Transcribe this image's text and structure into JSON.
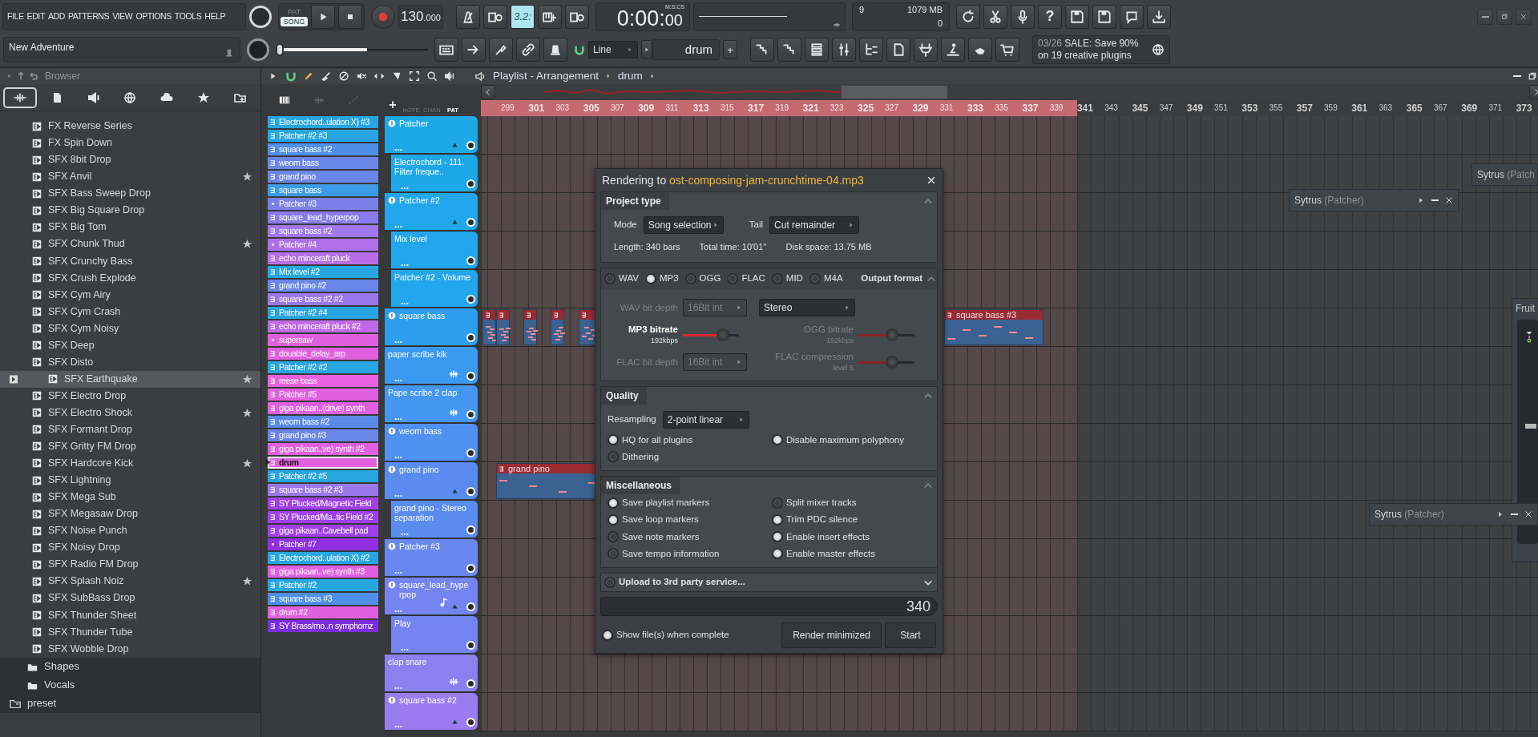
{
  "menu": [
    "FILE",
    "EDIT",
    "ADD",
    "PATTERNS",
    "VIEW",
    "OPTIONS",
    "TOOLS",
    "HELP"
  ],
  "transport": {
    "modes": [
      {
        "label": "PAT",
        "selected": false
      },
      {
        "label": "SONG",
        "selected": true
      }
    ],
    "tempo": "130",
    "tempo_fraction": ".000"
  },
  "tools": {
    "countdown": {
      "label": "3.2:",
      "on": true
    },
    "help": "?"
  },
  "time": {
    "main": "0:00:",
    "small": "00",
    "format": "M:S:CS"
  },
  "monitor": {
    "readout_1": "9",
    "memory": "1079 MB",
    "readout_2": "0"
  },
  "project_title": "New Adventure",
  "master_volume": {
    "level": 0.6
  },
  "snap": "Line",
  "pattern_selector": {
    "value": "drum",
    "add": "+"
  },
  "news": {
    "date": "03/26",
    "text": "SALE: Save 90% on 19 creative plugins"
  },
  "browser": {
    "title": "Browser",
    "tabs": [
      {
        "selected": true
      },
      {
        "selected": false
      },
      {
        "selected": false
      },
      {
        "selected": false
      },
      {
        "selected": false
      },
      {
        "selected": false
      },
      {
        "selected": false
      }
    ],
    "items": [
      {
        "name": "FX Reverse Series",
        "starred": false,
        "selected": false
      },
      {
        "name": "FX Spin Down",
        "starred": false,
        "selected": false
      },
      {
        "name": "SFX 8bit Drop",
        "starred": false,
        "selected": false
      },
      {
        "name": "SFX Anvil",
        "starred": true,
        "selected": false
      },
      {
        "name": "SFX Bass Sweep Drop",
        "starred": false,
        "selected": false
      },
      {
        "name": "SFX Big Square Drop",
        "starred": false,
        "selected": false
      },
      {
        "name": "SFX Big Tom",
        "starred": false,
        "selected": false
      },
      {
        "name": "SFX Chunk Thud",
        "starred": true,
        "selected": false
      },
      {
        "name": "SFX Crunchy Bass",
        "starred": false,
        "selected": false
      },
      {
        "name": "SFX Crush Explode",
        "starred": false,
        "selected": false
      },
      {
        "name": "SFX Cym Airy",
        "starred": false,
        "selected": false
      },
      {
        "name": "SFX Cym Crash",
        "starred": false,
        "selected": false
      },
      {
        "name": "SFX Cym Noisy",
        "starred": false,
        "selected": false
      },
      {
        "name": "SFX Deep",
        "starred": false,
        "selected": false
      },
      {
        "name": "SFX Disto",
        "starred": false,
        "selected": false
      },
      {
        "name": "SFX Earthquake",
        "starred": true,
        "selected": true
      },
      {
        "name": "SFX Electro Drop",
        "starred": false,
        "selected": false
      },
      {
        "name": "SFX Electro Shock",
        "starred": true,
        "selected": false
      },
      {
        "name": "SFX Formant Drop",
        "starred": false,
        "selected": false
      },
      {
        "name": "SFX Gritty FM Drop",
        "starred": false,
        "selected": false
      },
      {
        "name": "SFX Hardcore Kick",
        "starred": true,
        "selected": false
      },
      {
        "name": "SFX Lightning",
        "starred": false,
        "selected": false
      },
      {
        "name": "SFX Mega Sub",
        "starred": false,
        "selected": false
      },
      {
        "name": "SFX Megasaw Drop",
        "starred": false,
        "selected": false
      },
      {
        "name": "SFX Noise Punch",
        "starred": false,
        "selected": false
      },
      {
        "name": "SFX Noisy Drop",
        "starred": false,
        "selected": false
      },
      {
        "name": "SFX Radio FM Drop",
        "starred": false,
        "selected": false
      },
      {
        "name": "SFX Splash Noiz",
        "starred": true,
        "selected": false
      },
      {
        "name": "SFX SubBass Drop",
        "starred": false,
        "selected": false
      },
      {
        "name": "SFX Thunder Sheet",
        "starred": false,
        "selected": false
      },
      {
        "name": "SFX Thunder Tube",
        "starred": false,
        "selected": false
      },
      {
        "name": "SFX Wobble Drop",
        "starred": false,
        "selected": false
      }
    ],
    "folders": [
      {
        "name": "Shapes"
      },
      {
        "name": "Vocals"
      }
    ],
    "places": [
      {
        "name": "preset"
      }
    ]
  },
  "patterns": [
    {
      "name": "Electrochord..ulation X) #3",
      "kind": "pattern",
      "color": "#27a6e2",
      "selected": false
    },
    {
      "name": "Patcher #2 #3",
      "kind": "pattern",
      "color": "#27a6e2",
      "selected": false
    },
    {
      "name": "square bass #2",
      "kind": "pattern",
      "color": "#4f8fe8",
      "selected": false
    },
    {
      "name": "weom bass",
      "kind": "pattern",
      "color": "#6a86e8",
      "selected": false
    },
    {
      "name": "grand pino",
      "kind": "pattern",
      "color": "#6a86e8",
      "selected": false
    },
    {
      "name": "square bass",
      "kind": "pattern",
      "color": "#3c9be6",
      "selected": false
    },
    {
      "name": "Patcher #3",
      "kind": "automation",
      "color": "#7b80ea",
      "selected": false
    },
    {
      "name": "square_lead_hyperpop",
      "kind": "pattern",
      "color": "#8a7bec",
      "selected": false
    },
    {
      "name": "square bass #2",
      "kind": "pattern",
      "color": "#a077ec",
      "selected": false
    },
    {
      "name": "Patcher #4",
      "kind": "automation",
      "color": "#b070ea",
      "selected": false
    },
    {
      "name": "echo minceraft pluck",
      "kind": "pattern",
      "color": "#b86ee6",
      "selected": false
    },
    {
      "name": "Mix level #2",
      "kind": "pattern",
      "color": "#27a6e2",
      "selected": false
    },
    {
      "name": "grand pino #2",
      "kind": "pattern",
      "color": "#6a86e8",
      "selected": false
    },
    {
      "name": "square bass #2 #2",
      "kind": "pattern",
      "color": "#9a78ec",
      "selected": false
    },
    {
      "name": "Patcher #2 #4",
      "kind": "pattern",
      "color": "#27a6e2",
      "selected": false
    },
    {
      "name": "echo minceraft pluck #2",
      "kind": "pattern",
      "color": "#c06ae6",
      "selected": false
    },
    {
      "name": "supersaw",
      "kind": "automation",
      "color": "#e060e0",
      "selected": false
    },
    {
      "name": "douable_delay_arp",
      "kind": "pattern",
      "color": "#e060e0",
      "selected": false
    },
    {
      "name": "Patcher #2 #2",
      "kind": "pattern",
      "color": "#27a6e2",
      "selected": false
    },
    {
      "name": "reese bass",
      "kind": "pattern",
      "color": "#e862e0",
      "selected": false
    },
    {
      "name": "Patcher #5",
      "kind": "pattern",
      "color": "#e060e0",
      "selected": false
    },
    {
      "name": "giga pikaan..(drive) synth",
      "kind": "pattern",
      "color": "#e060e0",
      "selected": false
    },
    {
      "name": "weom bass #2",
      "kind": "pattern",
      "color": "#5a8ae8",
      "selected": false
    },
    {
      "name": "grand pino #3",
      "kind": "pattern",
      "color": "#6a86e8",
      "selected": false
    },
    {
      "name": "giga pikaan..ve) synth #2",
      "kind": "pattern",
      "color": "#e060e0",
      "selected": false
    },
    {
      "name": "drum",
      "kind": "pattern",
      "color": "#e060e0",
      "selected": true
    },
    {
      "name": "Patcher #2 #5",
      "kind": "pattern",
      "color": "#27a6e2",
      "selected": false
    },
    {
      "name": "square bass #2 #3",
      "kind": "pattern",
      "color": "#9a78ec",
      "selected": false
    },
    {
      "name": "SY Plucked/Magnetic Field",
      "kind": "pattern",
      "color": "#a040e8",
      "selected": false
    },
    {
      "name": "SY Plucked/Ma..tic Field #2",
      "kind": "pattern",
      "color": "#a040e8",
      "selected": false
    },
    {
      "name": "giga pikaan..Cavebell pad",
      "kind": "pattern",
      "color": "#a040e8",
      "selected": false
    },
    {
      "name": "Patcher #7",
      "kind": "automation",
      "color": "#9030e0",
      "selected": false
    },
    {
      "name": "Electrochord..ulation X) #2",
      "kind": "pattern",
      "color": "#27a6e2",
      "selected": false
    },
    {
      "name": "giga pikaan..ve) synth #3",
      "kind": "pattern",
      "color": "#e060e0",
      "selected": false
    },
    {
      "name": "Patcher #2",
      "kind": "pattern",
      "color": "#27a6e2",
      "selected": false
    },
    {
      "name": "square bass #3",
      "kind": "pattern",
      "color": "#4f8fe8",
      "selected": false
    },
    {
      "name": "drum #2",
      "kind": "pattern",
      "color": "#e060e0",
      "selected": false
    },
    {
      "name": "SY Brass/mo..n symphornz",
      "kind": "pattern",
      "color": "#7a2ee0",
      "selected": false
    }
  ],
  "playlist": {
    "title": "Playlist - Arrangement",
    "pattern": "drum",
    "add": "+",
    "view_tabs": [
      {
        "label": "NOTE",
        "selected": false
      },
      {
        "label": "CHAN",
        "selected": false
      },
      {
        "label": "PAT",
        "selected": true
      }
    ],
    "ruler": [
      {
        "label": "299",
        "selected": true
      },
      {
        "label": "301",
        "selected": true
      },
      {
        "label": "303",
        "selected": true
      },
      {
        "label": "305",
        "selected": true
      },
      {
        "label": "307",
        "selected": true
      },
      {
        "label": "309",
        "selected": true
      },
      {
        "label": "311",
        "selected": true
      },
      {
        "label": "313",
        "selected": true
      },
      {
        "label": "315",
        "selected": true
      },
      {
        "label": "317",
        "selected": true
      },
      {
        "label": "319",
        "selected": true
      },
      {
        "label": "321",
        "selected": true
      },
      {
        "label": "323",
        "selected": true
      },
      {
        "label": "325",
        "selected": true
      },
      {
        "label": "327",
        "selected": true
      },
      {
        "label": "329",
        "selected": true
      },
      {
        "label": "331",
        "selected": true
      },
      {
        "label": "333",
        "selected": true
      },
      {
        "label": "335",
        "selected": true
      },
      {
        "label": "337",
        "selected": true
      },
      {
        "label": "339",
        "selected": true
      },
      {
        "label": "341",
        "selected": false
      },
      {
        "label": "343",
        "selected": false
      },
      {
        "label": "345",
        "selected": false
      },
      {
        "label": "347",
        "selected": false
      },
      {
        "label": "349",
        "selected": false
      },
      {
        "label": "351",
        "selected": false
      },
      {
        "label": "353",
        "selected": false
      },
      {
        "label": "355",
        "selected": false
      },
      {
        "label": "357",
        "selected": false
      },
      {
        "label": "359",
        "selected": false
      },
      {
        "label": "361",
        "selected": false
      },
      {
        "label": "363",
        "selected": false
      },
      {
        "label": "365",
        "selected": false
      },
      {
        "label": "367",
        "selected": false
      },
      {
        "label": "369",
        "selected": false
      },
      {
        "label": "371",
        "selected": false
      },
      {
        "label": "373",
        "selected": false
      }
    ],
    "tracks": [
      {
        "name": "Patcher",
        "kind": "instrument",
        "color": "#1ea8e8",
        "expanded": true,
        "menu": "...",
        "children": [
          {
            "name": "Electrochord - 111. Filter freque..",
            "kind": "automation",
            "menu": "..."
          }
        ]
      },
      {
        "name": "Patcher #2",
        "kind": "instrument",
        "color": "#22a6ec",
        "expanded": true,
        "menu": "...",
        "children": [
          {
            "name": "Mix level",
            "kind": "automation",
            "menu": "..."
          },
          {
            "name": "Patcher #2 - Volume",
            "kind": "automation",
            "menu": "..."
          }
        ]
      },
      {
        "name": "square bass",
        "kind": "instrument",
        "color": "#2e9eee",
        "expanded": false,
        "menu": "...",
        "clips": [
          {
            "kind": "short"
          },
          {
            "kind": "short"
          },
          {
            "kind": "short"
          },
          {
            "kind": "short"
          },
          {
            "kind": "short"
          },
          {
            "kind": "labeled",
            "label": "square bass #3"
          }
        ]
      },
      {
        "name": "paper scribe kik",
        "kind": "audio",
        "color": "#3a9af0",
        "menu": "..."
      },
      {
        "name": "Pape scribe 2 clap",
        "kind": "audio",
        "color": "#4496f0",
        "menu": "..."
      },
      {
        "name": "weom bass",
        "kind": "instrument",
        "color": "#5090f0",
        "expanded": false,
        "menu": "..."
      },
      {
        "name": "grand pino",
        "kind": "instrument",
        "color": "#5a8cf0",
        "expanded": true,
        "menu": "...",
        "clips": [
          {
            "kind": "labeled",
            "label": "grand pino"
          }
        ],
        "children": [
          {
            "name": "grand pino - Stereo separation",
            "kind": "automation",
            "menu": "..."
          }
        ]
      },
      {
        "name": "Patcher #3",
        "kind": "instrument",
        "color": "#6888f0",
        "expanded": false,
        "menu": "..."
      },
      {
        "name": "square_lead_hyperpop",
        "kind": "instrument",
        "color": "#7484f0",
        "expanded": true,
        "note": true,
        "menu": "...",
        "children": [
          {
            "name": "Play",
            "kind": "automation",
            "menu": "..."
          }
        ]
      },
      {
        "name": "clap snare",
        "kind": "audio",
        "color": "#8a80f0",
        "menu": "..."
      },
      {
        "name": "square bass #2",
        "kind": "instrument",
        "color": "#9a7cf0",
        "expanded": true,
        "menu": "..."
      }
    ],
    "floating_windows": [
      {
        "title": "Sytrus",
        "subtitle": "(Patch"
      },
      {
        "title": "Sytrus",
        "subtitle": "(Patcher)"
      },
      {
        "title": "Sytrus",
        "subtitle": "(Patcher)"
      }
    ],
    "side_panel": {
      "title": "Fruit"
    }
  },
  "render_dialog": {
    "title": "Rendering to",
    "filename": "ost-composing-jam-crunchtime-04.mp3",
    "project_type": {
      "title": "Project type",
      "mode_label": "Mode",
      "mode": "Song selection",
      "tail_label": "Tail",
      "tail": "Cut remainder",
      "length": "Length: 340 bars",
      "total_time": "Total time: 10'01''",
      "disk_space": "Disk space: 13.75 MB"
    },
    "output_format": {
      "title": "Output format",
      "formats": [
        {
          "label": "WAV",
          "selected": false
        },
        {
          "label": "MP3",
          "selected": true
        },
        {
          "label": "OGG",
          "selected": false
        },
        {
          "label": "FLAC",
          "selected": false
        },
        {
          "label": "MID",
          "selected": false
        },
        {
          "label": "M4A",
          "selected": false
        }
      ],
      "settings": [
        {
          "kind": "dropdown",
          "label": "WAV bit depth",
          "value": "16Bit int",
          "disabled": true
        },
        {
          "kind": "dropdown",
          "value": "Stereo",
          "disabled": false
        },
        {
          "kind": "slider",
          "label": "MP3 bitrate",
          "reading": "192kbps",
          "level": 0.72,
          "disabled": false
        },
        {
          "kind": "slider",
          "label": "OGG bitrate",
          "reading": "192kbps",
          "level": 0.6,
          "disabled": true
        },
        {
          "kind": "dropdown",
          "label": "FLAC bit depth",
          "value": "16Bit int",
          "disabled": true
        },
        {
          "kind": "slider",
          "label": "FLAC compression",
          "reading": "level 5",
          "level": 0.6,
          "disabled": true
        }
      ]
    },
    "quality": {
      "title": "Quality",
      "resampling_label": "Resampling",
      "resampling": "2-point linear",
      "options": [
        {
          "label": "HQ for all plugins",
          "checked": true
        },
        {
          "label": "Disable maximum polyphony",
          "checked": true
        },
        {
          "label": "Dithering",
          "checked": false
        }
      ]
    },
    "misc": {
      "title": "Miscellaneous",
      "options": [
        {
          "label": "Save playlist markers",
          "checked": true
        },
        {
          "label": "Split mixer tracks",
          "checked": false
        },
        {
          "label": "Save loop markers",
          "checked": true
        },
        {
          "label": "Trim PDC silence",
          "checked": true
        },
        {
          "label": "Save note markers",
          "checked": false
        },
        {
          "label": "Enable insert effects",
          "checked": true
        },
        {
          "label": "Save tempo information",
          "checked": false
        },
        {
          "label": "Enable master effects",
          "checked": true
        }
      ]
    },
    "upload": {
      "label": "Upload to 3rd party service...",
      "checked": false
    },
    "progress": "340",
    "show_files": {
      "label": "Show file(s) when complete",
      "checked": true
    },
    "buttons": [
      "Render minimized",
      "Start"
    ]
  }
}
